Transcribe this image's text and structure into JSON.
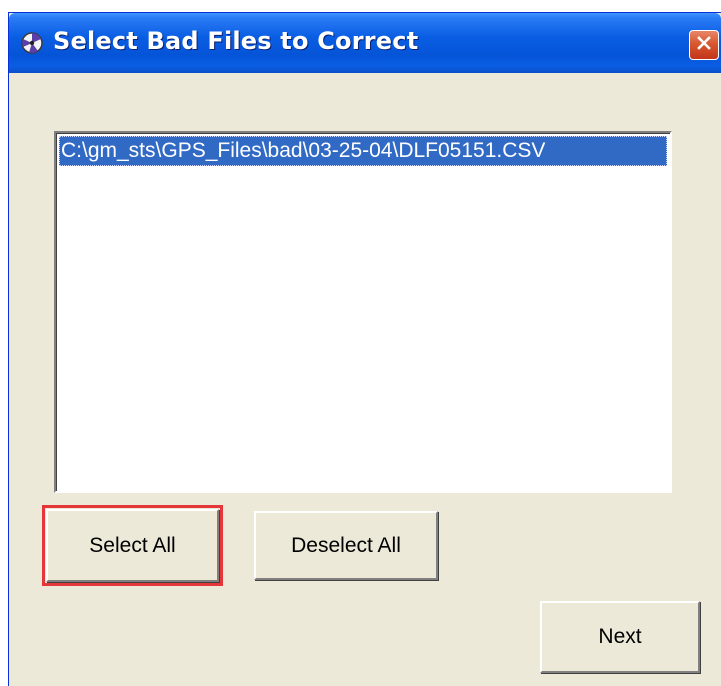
{
  "window": {
    "title": "Select Bad Files to Correct",
    "icon": "app-icon",
    "close_icon": "close-icon",
    "titlebar_color": "#0a5ee3",
    "body_color": "#ece9d8"
  },
  "file_list": {
    "items": [
      {
        "path": "C:\\gm_sts\\GPS_Files\\bad\\03-25-04\\DLF05151.CSV",
        "selected": true
      }
    ],
    "selection_color": "#316ac5"
  },
  "buttons": {
    "select_all": "Select All",
    "deselect_all": "Deselect All",
    "next": "Next"
  },
  "highlight": {
    "target": "select_all",
    "color": "#e5373a"
  }
}
